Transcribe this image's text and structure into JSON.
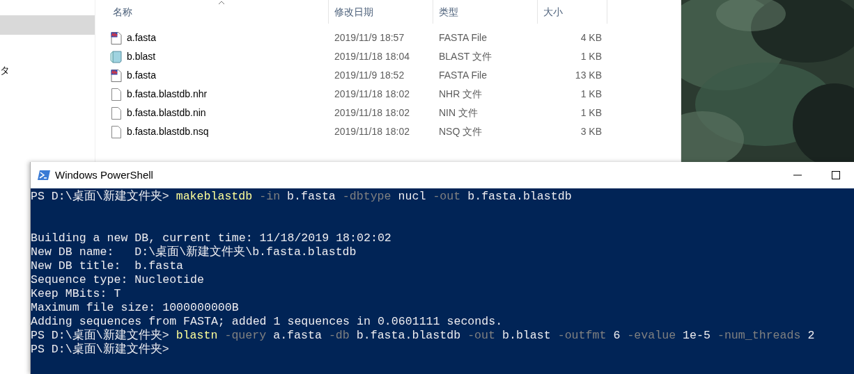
{
  "explorer": {
    "nav_pane": {
      "items": [
        {
          "selected": true
        },
        {
          "label": "タ",
          "selected": false
        }
      ]
    },
    "columns": [
      {
        "label": "名称",
        "sorted": true
      },
      {
        "label": "修改日期",
        "sorted": false
      },
      {
        "label": "类型",
        "sorted": false
      },
      {
        "label": "大小",
        "sorted": false
      }
    ],
    "files": [
      {
        "name": "a.fasta",
        "kind": "fasta",
        "modified": "2019/11/9 18:57",
        "type": "FASTA File",
        "size": "4 KB"
      },
      {
        "name": "b.blast",
        "kind": "notepad",
        "modified": "2019/11/18 18:04",
        "type": "BLAST 文件",
        "size": "1 KB"
      },
      {
        "name": "b.fasta",
        "kind": "fasta",
        "modified": "2019/11/9 18:52",
        "type": "FASTA File",
        "size": "13 KB"
      },
      {
        "name": "b.fasta.blastdb.nhr",
        "kind": "blank",
        "modified": "2019/11/18 18:02",
        "type": "NHR 文件",
        "size": "1 KB"
      },
      {
        "name": "b.fasta.blastdb.nin",
        "kind": "blank",
        "modified": "2019/11/18 18:02",
        "type": "NIN 文件",
        "size": "1 KB"
      },
      {
        "name": "b.fasta.blastdb.nsq",
        "kind": "blank",
        "modified": "2019/11/18 18:02",
        "type": "NSQ 文件",
        "size": "3 KB"
      }
    ]
  },
  "powershell": {
    "title": "Windows PowerShell",
    "lines": [
      {
        "kind": "command",
        "prompt": "PS D:\\桌面\\新建文件夹>",
        "tokens": [
          {
            "kind": "command",
            "text": "makeblastdb"
          },
          {
            "kind": "parameter",
            "text": "-in"
          },
          {
            "kind": "argument",
            "text": "b.fasta"
          },
          {
            "kind": "parameter",
            "text": "-dbtype"
          },
          {
            "kind": "argument",
            "text": "nucl"
          },
          {
            "kind": "parameter",
            "text": "-out"
          },
          {
            "kind": "argument",
            "text": "b.fasta.blastdb"
          }
        ]
      },
      {
        "kind": "blank"
      },
      {
        "kind": "blank"
      },
      {
        "kind": "output",
        "text": "Building a new DB, current time: 11/18/2019 18:02:02"
      },
      {
        "kind": "output",
        "text": "New DB name:   D:\\桌面\\新建文件夹\\b.fasta.blastdb"
      },
      {
        "kind": "output",
        "text": "New DB title:  b.fasta"
      },
      {
        "kind": "output",
        "text": "Sequence type: Nucleotide"
      },
      {
        "kind": "output",
        "text": "Keep MBits: T"
      },
      {
        "kind": "output",
        "text": "Maximum file size: 1000000000B"
      },
      {
        "kind": "output",
        "text": "Adding sequences from FASTA; added 1 sequences in 0.0601111 seconds."
      },
      {
        "kind": "command",
        "prompt": "PS D:\\桌面\\新建文件夹>",
        "tokens": [
          {
            "kind": "command",
            "text": "blastn"
          },
          {
            "kind": "parameter",
            "text": "-query"
          },
          {
            "kind": "argument",
            "text": "a.fasta"
          },
          {
            "kind": "parameter",
            "text": "-db"
          },
          {
            "kind": "argument",
            "text": "b.fasta.blastdb"
          },
          {
            "kind": "parameter",
            "text": "-out"
          },
          {
            "kind": "argument",
            "text": "b.blast"
          },
          {
            "kind": "parameter",
            "text": "-outfmt"
          },
          {
            "kind": "argument",
            "text": "6"
          },
          {
            "kind": "parameter",
            "text": "-evalue"
          },
          {
            "kind": "argument",
            "text": "1e-5"
          },
          {
            "kind": "parameter",
            "text": "-num_threads"
          },
          {
            "kind": "argument",
            "text": "2"
          }
        ]
      },
      {
        "kind": "command",
        "prompt": "PS D:\\桌面\\新建文件夹>"
      }
    ]
  }
}
